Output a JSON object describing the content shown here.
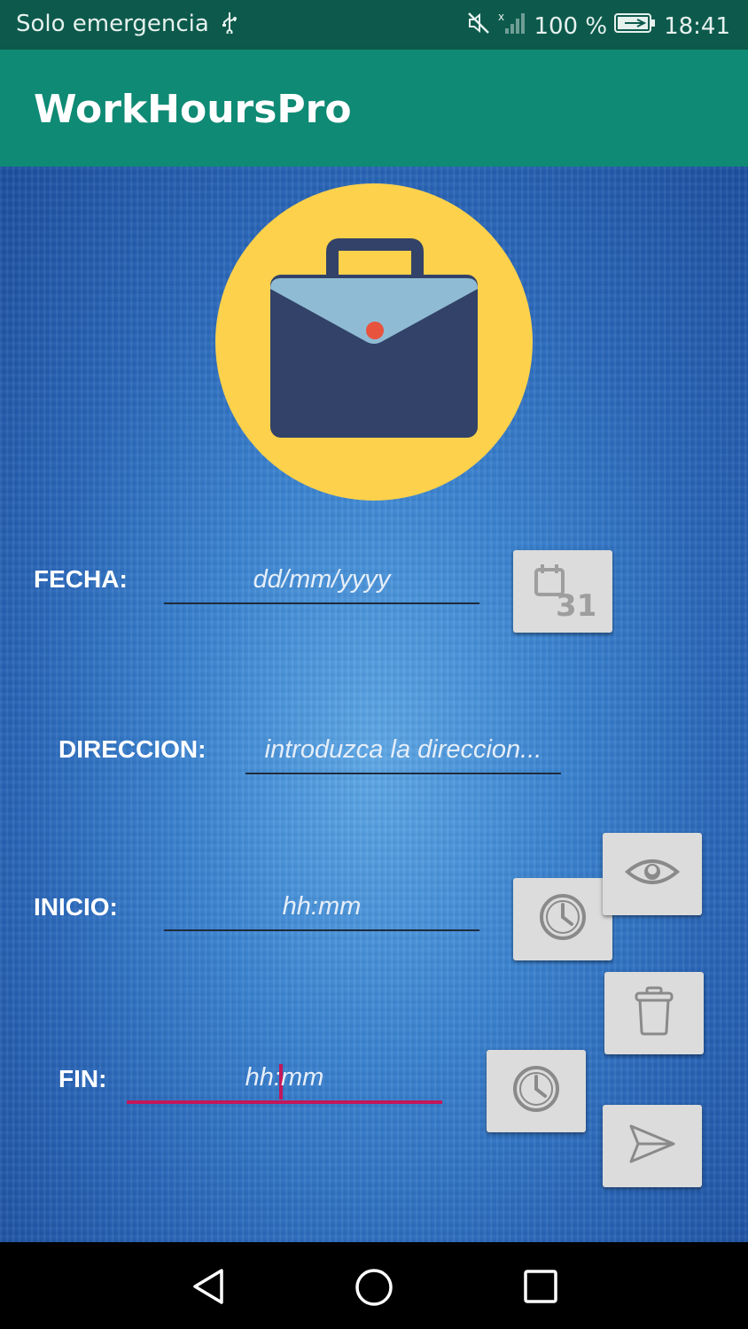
{
  "status_bar": {
    "carrier": "Solo emergencia",
    "battery": "100 %",
    "time": "18:41",
    "icons": [
      "usb-icon",
      "mute-icon",
      "no-signal-icon",
      "battery-charging-icon"
    ]
  },
  "app_bar": {
    "title": "WorkHoursPro"
  },
  "form": {
    "fecha": {
      "label": "FECHA:",
      "placeholder": "dd/mm/yyyy"
    },
    "direccion": {
      "label": "DIRECCION:",
      "placeholder": "introduzca la direccion..."
    },
    "inicio": {
      "label": "INICIO:",
      "placeholder": "hh:mm"
    },
    "fin": {
      "label": "FIN:",
      "placeholder_before_cursor": "hh:",
      "placeholder_after_cursor": "mm"
    }
  },
  "buttons": {
    "calendar": {
      "icon": "calendar-icon",
      "number": "31"
    },
    "inicio_clock": {
      "icon": "clock-icon"
    },
    "fin_clock": {
      "icon": "clock-icon"
    },
    "view": {
      "icon": "eye-icon"
    },
    "delete": {
      "icon": "trash-icon"
    },
    "send": {
      "icon": "send-icon"
    }
  },
  "colors": {
    "app_bar": "#0f8a74",
    "status_bar": "#0d5a4c",
    "accent": "#c2185b",
    "logo_circle": "#fdd14b",
    "briefcase": "#324268",
    "briefcase_flap": "#8fbcd4",
    "button_bg": "#dcdcdc"
  }
}
